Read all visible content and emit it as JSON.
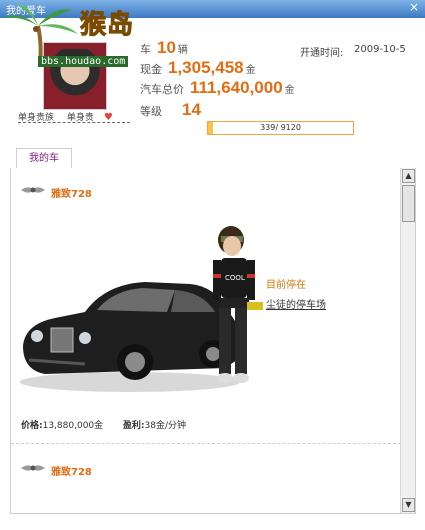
{
  "window": {
    "title": "我的爱车",
    "close": "×"
  },
  "logo": {
    "text": "猴岛",
    "url": "bbs.houdao.com"
  },
  "profile": {
    "links": [
      "单身贵族",
      "单身贵"
    ],
    "stats": {
      "car_label": "车",
      "car_count": "10",
      "car_unit": "辆",
      "cash_label": "现金",
      "cash_value": "1,305,458",
      "cash_unit": "金",
      "total_label": "汽车总价",
      "total_value": "111,640,000",
      "total_unit": "金",
      "level_label": "等级",
      "level_value": "14"
    },
    "opened_label": "开通时间:",
    "opened_date": "2009-10-5",
    "level_progress_text": "339/ 9120",
    "level_progress": 0.037
  },
  "tabs": {
    "my_cars": "我的车"
  },
  "cars": [
    {
      "name": "雅致728",
      "status": "目前停在",
      "location": "尘徒的停车场",
      "price_label": "价格:",
      "price": "13,880,000金",
      "profit_label": "盈利:",
      "profit": "38金/分钟"
    },
    {
      "name": "雅致728"
    }
  ],
  "colors": {
    "accent": "#e36d12",
    "title_bar": "#3d78c2",
    "tab_text": "#8a1f8a"
  },
  "icons": [
    "close-icon",
    "bentley-logo-icon",
    "scroll-up-icon",
    "scroll-down-icon"
  ]
}
